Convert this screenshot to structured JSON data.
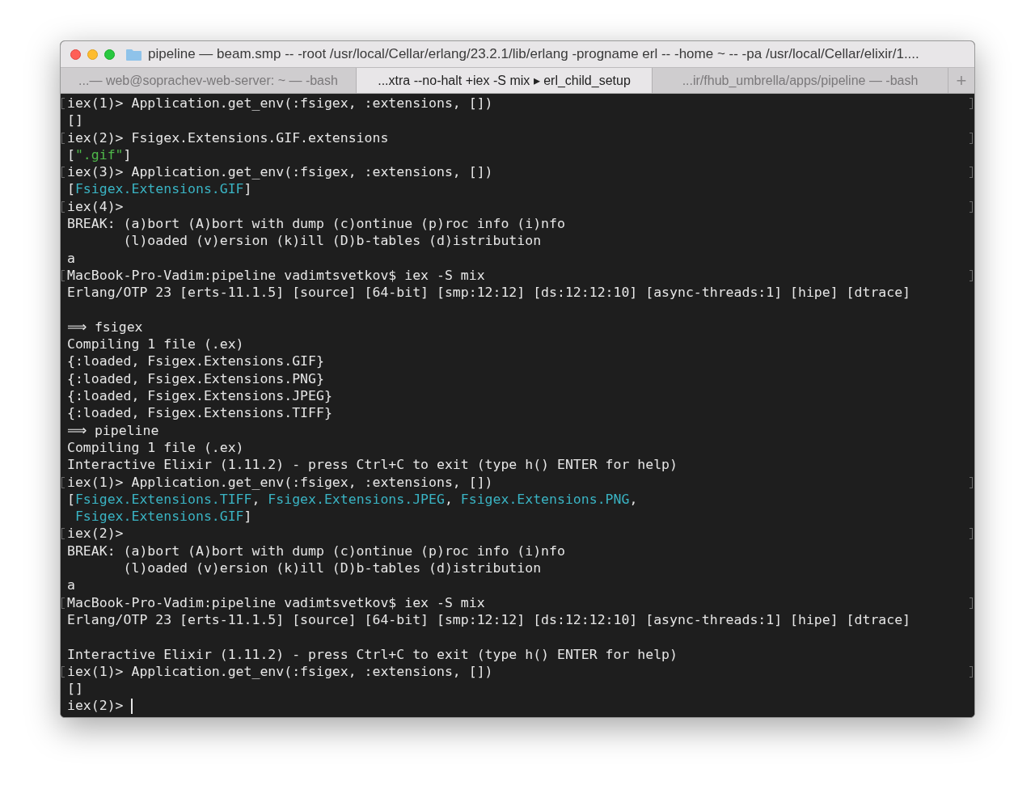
{
  "window": {
    "title": "pipeline — beam.smp -- -root /usr/local/Cellar/erlang/23.2.1/lib/erlang -progname erl -- -home ~ -- -pa /usr/local/Cellar/elixir/1...."
  },
  "tabs": [
    {
      "label": "...— web@soprachev-web-server: ~ — -bash",
      "selected": false
    },
    {
      "label": "...xtra --no-halt +iex -S mix ▸ erl_child_setup",
      "selected": true
    },
    {
      "label": "...ir/fhub_umbrella/apps/pipeline — -bash",
      "selected": false
    }
  ],
  "new_tab_button": "+",
  "terminal": {
    "lines": [
      {
        "kind": "text",
        "marked": true,
        "segments": [
          {
            "kind": "plain",
            "text": "iex(1)> Application.get_env(:fsigex, :extensions, [])"
          }
        ]
      },
      {
        "kind": "text",
        "marked": false,
        "segments": [
          {
            "kind": "plain",
            "text": "[]"
          }
        ]
      },
      {
        "kind": "text",
        "marked": true,
        "segments": [
          {
            "kind": "plain",
            "text": "iex(2)> Fsigex.Extensions.GIF.extensions"
          }
        ]
      },
      {
        "kind": "text",
        "marked": false,
        "segments": [
          {
            "kind": "plain",
            "text": "["
          },
          {
            "kind": "string",
            "text": "\".gif\""
          },
          {
            "kind": "plain",
            "text": "]"
          }
        ]
      },
      {
        "kind": "text",
        "marked": true,
        "segments": [
          {
            "kind": "plain",
            "text": "iex(3)> Application.get_env(:fsigex, :extensions, [])"
          }
        ]
      },
      {
        "kind": "text",
        "marked": false,
        "segments": [
          {
            "kind": "plain",
            "text": "["
          },
          {
            "kind": "module",
            "text": "Fsigex.Extensions.GIF"
          },
          {
            "kind": "plain",
            "text": "]"
          }
        ]
      },
      {
        "kind": "text",
        "marked": true,
        "segments": [
          {
            "kind": "plain",
            "text": "iex(4)>"
          }
        ]
      },
      {
        "kind": "text",
        "marked": false,
        "segments": [
          {
            "kind": "plain",
            "text": "BREAK: (a)bort (A)bort with dump (c)ontinue (p)roc info (i)nfo"
          }
        ]
      },
      {
        "kind": "text",
        "marked": false,
        "segments": [
          {
            "kind": "plain",
            "text": "       (l)oaded (v)ersion (k)ill (D)b-tables (d)istribution"
          }
        ]
      },
      {
        "kind": "text",
        "marked": false,
        "segments": [
          {
            "kind": "plain",
            "text": "a"
          }
        ]
      },
      {
        "kind": "text",
        "marked": true,
        "segments": [
          {
            "kind": "plain",
            "text": "MacBook-Pro-Vadim:pipeline vadimtsvetkov$ iex -S mix"
          }
        ]
      },
      {
        "kind": "text",
        "marked": false,
        "segments": [
          {
            "kind": "plain",
            "text": "Erlang/OTP 23 [erts-11.1.5] [source] [64-bit] [smp:12:12] [ds:12:12:10] [async-threads:1] [hipe] [dtrace]"
          }
        ]
      },
      {
        "kind": "blank",
        "marked": false
      },
      {
        "kind": "text",
        "marked": false,
        "segments": [
          {
            "kind": "plain",
            "text": "⟹ fsigex"
          }
        ]
      },
      {
        "kind": "text",
        "marked": false,
        "segments": [
          {
            "kind": "plain",
            "text": "Compiling 1 file (.ex)"
          }
        ]
      },
      {
        "kind": "text",
        "marked": false,
        "segments": [
          {
            "kind": "plain",
            "text": "{:loaded, Fsigex.Extensions.GIF}"
          }
        ]
      },
      {
        "kind": "text",
        "marked": false,
        "segments": [
          {
            "kind": "plain",
            "text": "{:loaded, Fsigex.Extensions.PNG}"
          }
        ]
      },
      {
        "kind": "text",
        "marked": false,
        "segments": [
          {
            "kind": "plain",
            "text": "{:loaded, Fsigex.Extensions.JPEG}"
          }
        ]
      },
      {
        "kind": "text",
        "marked": false,
        "segments": [
          {
            "kind": "plain",
            "text": "{:loaded, Fsigex.Extensions.TIFF}"
          }
        ]
      },
      {
        "kind": "text",
        "marked": false,
        "segments": [
          {
            "kind": "plain",
            "text": "⟹ pipeline"
          }
        ]
      },
      {
        "kind": "text",
        "marked": false,
        "segments": [
          {
            "kind": "plain",
            "text": "Compiling 1 file (.ex)"
          }
        ]
      },
      {
        "kind": "text",
        "marked": false,
        "segments": [
          {
            "kind": "plain",
            "text": "Interactive Elixir (1.11.2) - press Ctrl+C to exit (type h() ENTER for help)"
          }
        ]
      },
      {
        "kind": "text",
        "marked": true,
        "segments": [
          {
            "kind": "plain",
            "text": "iex(1)> Application.get_env(:fsigex, :extensions, [])"
          }
        ]
      },
      {
        "kind": "text",
        "marked": false,
        "segments": [
          {
            "kind": "plain",
            "text": "["
          },
          {
            "kind": "module",
            "text": "Fsigex.Extensions.TIFF"
          },
          {
            "kind": "plain",
            "text": ", "
          },
          {
            "kind": "module",
            "text": "Fsigex.Extensions.JPEG"
          },
          {
            "kind": "plain",
            "text": ", "
          },
          {
            "kind": "module",
            "text": "Fsigex.Extensions.PNG"
          },
          {
            "kind": "plain",
            "text": ","
          }
        ]
      },
      {
        "kind": "text",
        "marked": false,
        "segments": [
          {
            "kind": "module",
            "text": " Fsigex.Extensions.GIF"
          },
          {
            "kind": "plain",
            "text": "]"
          }
        ]
      },
      {
        "kind": "text",
        "marked": true,
        "segments": [
          {
            "kind": "plain",
            "text": "iex(2)>"
          }
        ]
      },
      {
        "kind": "text",
        "marked": false,
        "segments": [
          {
            "kind": "plain",
            "text": "BREAK: (a)bort (A)bort with dump (c)ontinue (p)roc info (i)nfo"
          }
        ]
      },
      {
        "kind": "text",
        "marked": false,
        "segments": [
          {
            "kind": "plain",
            "text": "       (l)oaded (v)ersion (k)ill (D)b-tables (d)istribution"
          }
        ]
      },
      {
        "kind": "text",
        "marked": false,
        "segments": [
          {
            "kind": "plain",
            "text": "a"
          }
        ]
      },
      {
        "kind": "text",
        "marked": true,
        "segments": [
          {
            "kind": "plain",
            "text": "MacBook-Pro-Vadim:pipeline vadimtsvetkov$ iex -S mix"
          }
        ]
      },
      {
        "kind": "text",
        "marked": false,
        "segments": [
          {
            "kind": "plain",
            "text": "Erlang/OTP 23 [erts-11.1.5] [source] [64-bit] [smp:12:12] [ds:12:12:10] [async-threads:1] [hipe] [dtrace]"
          }
        ]
      },
      {
        "kind": "blank",
        "marked": false
      },
      {
        "kind": "text",
        "marked": false,
        "segments": [
          {
            "kind": "plain",
            "text": "Interactive Elixir (1.11.2) - press Ctrl+C to exit (type h() ENTER for help)"
          }
        ]
      },
      {
        "kind": "text",
        "marked": true,
        "segments": [
          {
            "kind": "plain",
            "text": "iex(1)> Application.get_env(:fsigex, :extensions, [])"
          }
        ]
      },
      {
        "kind": "text",
        "marked": false,
        "segments": [
          {
            "kind": "plain",
            "text": "[]"
          }
        ]
      },
      {
        "kind": "text",
        "marked": false,
        "segments": [
          {
            "kind": "plain",
            "text": "iex(2)> "
          }
        ]
      }
    ],
    "cursor": {
      "visible": true
    }
  }
}
